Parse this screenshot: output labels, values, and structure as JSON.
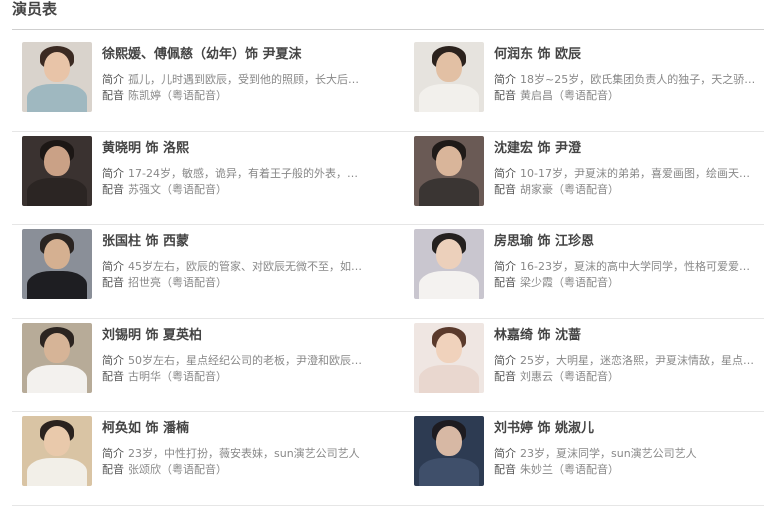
{
  "page": {
    "title": "演员表"
  },
  "cast": [
    [
      {
        "name": "徐熙媛、傅佩慈（幼年）饰 尹夏沫",
        "intro_label": "简介",
        "intro": "孤儿，儿时遇到欧辰，受到他的照顾，长大后…",
        "dub_label": "配音",
        "dub": "陈凯婷（粤语配音）",
        "colors": {
          "bg": "#d9d3cc",
          "face": "#e8c4a8",
          "hair": "#3b2a22",
          "body": "#9fb8c0"
        }
      },
      {
        "name": "何润东 饰 欧辰",
        "intro_label": "简介",
        "intro": "18岁~25岁，欧氏集团负责人的独子，天之骄…",
        "dub_label": "配音",
        "dub": "黄启昌（粤语配音）",
        "colors": {
          "bg": "#e6e3de",
          "face": "#e2c0a4",
          "hair": "#2b221d",
          "body": "#f2f0ec"
        }
      }
    ],
    [
      {
        "name": "黄晓明 饰 洛熙",
        "intro_label": "简介",
        "intro": "17-24岁，敏感，诡异，有着王子般的外表，…",
        "dub_label": "配音",
        "dub": "苏强文（粤语配音）",
        "colors": {
          "bg": "#3a3230",
          "face": "#caa186",
          "hair": "#1c1715",
          "body": "#2b2523"
        }
      },
      {
        "name": "沈建宏 饰 尹澄",
        "intro_label": "简介",
        "intro": "10-17岁，尹夏沫的弟弟，喜爱画图，绘画天…",
        "dub_label": "配音",
        "dub": "胡家豪（粤语配音）",
        "colors": {
          "bg": "#6a5a55",
          "face": "#d9b59a",
          "hair": "#1f1a18",
          "body": "#3a3533"
        }
      }
    ],
    [
      {
        "name": "张国柱 饰 西蒙",
        "intro_label": "简介",
        "intro": "45岁左右，欧辰的管家、对欧辰无微不至，如…",
        "dub_label": "配音",
        "dub": "招世亮（粤语配音）",
        "colors": {
          "bg": "#8a8f98",
          "face": "#d5b091",
          "hair": "#2a2421",
          "body": "#1e1e22"
        }
      },
      {
        "name": "房思瑜 饰 江珍恩",
        "intro_label": "简介",
        "intro": "16-23岁，夏沫的高中大学同学，性格可爱爱…",
        "dub_label": "配音",
        "dub": "梁少霞（粤语配音）",
        "colors": {
          "bg": "#c9c6cf",
          "face": "#ecd0bb",
          "hair": "#24201f",
          "body": "#f4f2f0"
        }
      }
    ],
    [
      {
        "name": "刘锡明 饰 夏英柏",
        "intro_label": "简介",
        "intro": "50岁左右，星点经纪公司的老板，尹澄和欧辰…",
        "dub_label": "配音",
        "dub": "古明华（粤语配音）",
        "colors": {
          "bg": "#b7ab98",
          "face": "#d6b497",
          "hair": "#2b2420",
          "body": "#f3f1ee"
        }
      },
      {
        "name": "林嘉绮 饰 沈蔷",
        "intro_label": "简介",
        "intro": "25岁，大明星，迷恋洛熙，尹夏沫情敌，星点…",
        "dub_label": "配音",
        "dub": "刘惠云（粤语配音）",
        "colors": {
          "bg": "#efe6e2",
          "face": "#f0d2bc",
          "hair": "#5a3a2c",
          "body": "#e9d7cf"
        }
      }
    ],
    [
      {
        "name": "柯奂如 饰 潘楠",
        "intro_label": "简介",
        "intro": "23岁，中性打扮，薇安表妹，sun演艺公司艺人",
        "dub_label": "配音",
        "dub": "张颂欣（粤语配音）",
        "colors": {
          "bg": "#d9c4a4",
          "face": "#e9c9ab",
          "hair": "#2a221e",
          "body": "#f2efe8"
        }
      },
      {
        "name": "刘书婷 饰 姚淑儿",
        "intro_label": "简介",
        "intro": "23岁，夏沫同学，sun演艺公司艺人",
        "dub_label": "配音",
        "dub": "朱妙兰（粤语配音）",
        "colors": {
          "bg": "#2d3b52",
          "face": "#d7b8a4",
          "hair": "#1d1b20",
          "body": "#3f4f6a"
        }
      }
    ]
  ]
}
